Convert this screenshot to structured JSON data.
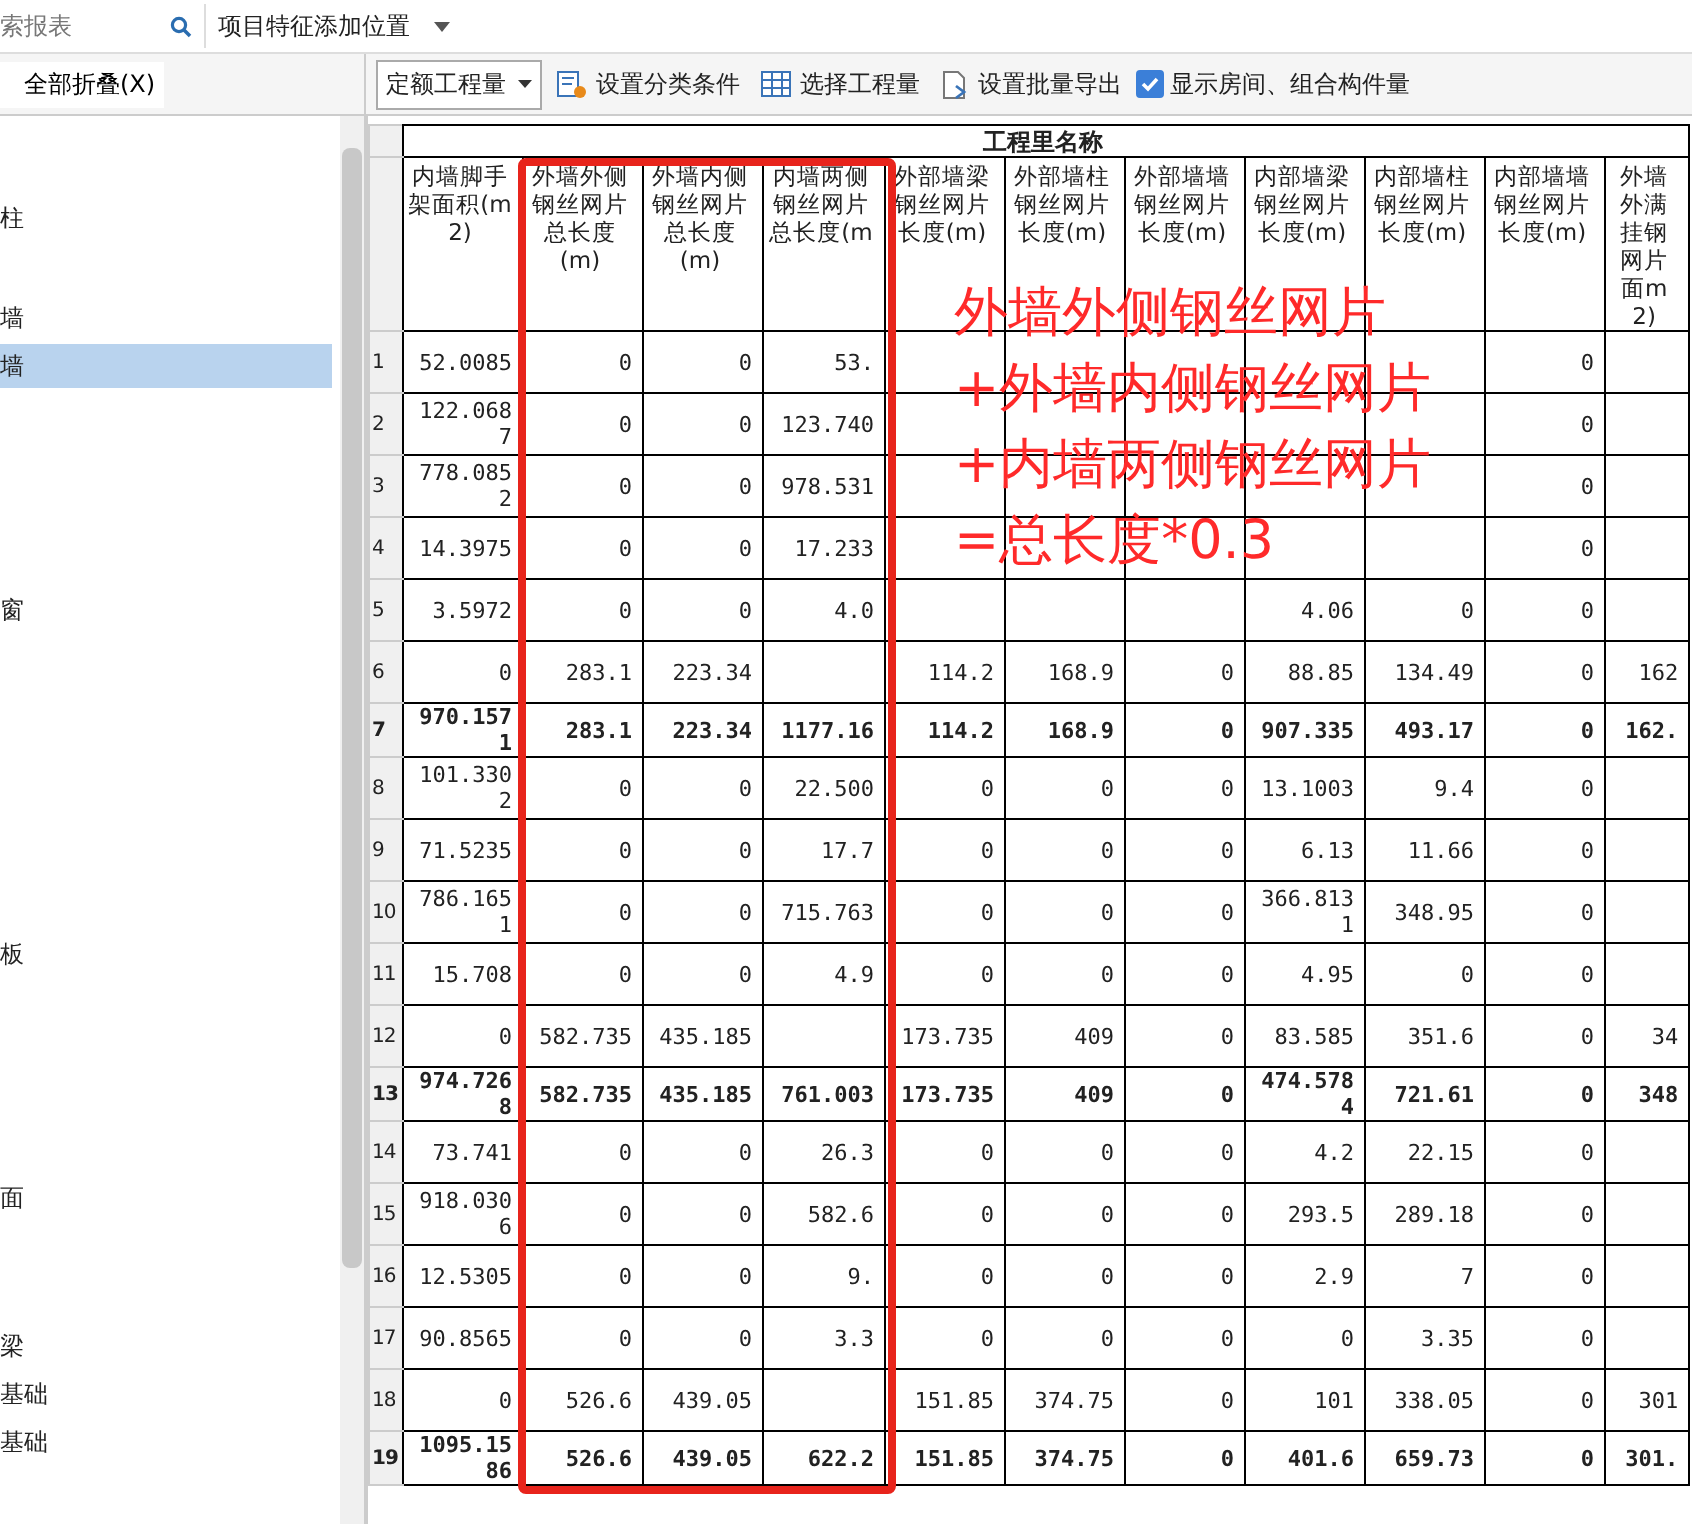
{
  "top_bar": {
    "search": {
      "value": "索报表"
    },
    "position_dropdown": "项目特征添加位置"
  },
  "sidebar": {
    "collapse_all": "全部折叠(X)",
    "items": [
      {
        "label": "柱",
        "selected": false
      },
      {
        "label": "墙",
        "selected": false
      },
      {
        "label": "墙",
        "selected": true
      },
      {
        "label": "窗",
        "selected": false
      },
      {
        "label": "板",
        "selected": false
      },
      {
        "label": "面",
        "selected": false
      },
      {
        "label": "梁",
        "selected": false
      },
      {
        "label": "基础",
        "selected": false
      },
      {
        "label": "基础",
        "selected": false
      }
    ]
  },
  "toolbar": {
    "quantity_dropdown": "定额工程量",
    "buttons": [
      "设置分类条件",
      "选择工程量",
      "设置批量导出"
    ],
    "show_rooms": {
      "label": "显示房间、组合构件量",
      "checked": true
    }
  },
  "table": {
    "group_header": "工程里名称",
    "columns": [
      "内墙脚手架面积(m2)",
      "外墙外侧钢丝网片总长度(m)",
      "外墙内侧钢丝网片总长度(m)",
      "内墙两侧钢丝网片总长度(m",
      "外部墙梁钢丝网片长度(m)",
      "外部墙柱钢丝网片长度(m)",
      "外部墙墙钢丝网片长度(m)",
      "内部墙梁钢丝网片长度(m)",
      "内部墙柱钢丝网片长度(m)",
      "内部墙墙钢丝网片长度(m)",
      "外墙外满挂钢网片面m2)"
    ],
    "rows": [
      {
        "num": "1",
        "kind": "detail",
        "cells": [
          "52.0085",
          "0",
          "0",
          "53.",
          null,
          null,
          null,
          null,
          null,
          "0",
          null
        ]
      },
      {
        "num": "2",
        "kind": "detail",
        "cells": [
          "122.0687",
          "0",
          "0",
          "123.740",
          null,
          null,
          null,
          null,
          null,
          "0",
          null
        ]
      },
      {
        "num": "3",
        "kind": "detail",
        "cells": [
          "778.0852",
          "0",
          "0",
          "978.531",
          null,
          null,
          null,
          null,
          null,
          "0",
          null
        ]
      },
      {
        "num": "4",
        "kind": "detail",
        "cells": [
          "14.3975",
          "0",
          "0",
          "17.233",
          null,
          null,
          null,
          null,
          null,
          "0",
          null
        ]
      },
      {
        "num": "5",
        "kind": "detail",
        "cells": [
          "3.5972",
          "0",
          "0",
          "4.0",
          null,
          null,
          null,
          "4.06",
          "0",
          "0",
          null
        ]
      },
      {
        "num": "6",
        "kind": "detail",
        "cells": [
          "0",
          "283.1",
          "223.34",
          null,
          "114.2",
          "168.9",
          "0",
          "88.85",
          "134.49",
          "0",
          "162"
        ]
      },
      {
        "num": "7",
        "kind": "total",
        "cells": [
          "970.1571",
          "283.1",
          "223.34",
          "1177.16",
          "114.2",
          "168.9",
          "0",
          "907.335",
          "493.17",
          "0",
          "162."
        ]
      },
      {
        "num": "8",
        "kind": "detail",
        "cells": [
          "101.3302",
          "0",
          "0",
          "22.500",
          "0",
          "0",
          "0",
          "13.1003",
          "9.4",
          "0",
          null
        ]
      },
      {
        "num": "9",
        "kind": "detail",
        "cells": [
          "71.5235",
          "0",
          "0",
          "17.7",
          "0",
          "0",
          "0",
          "6.13",
          "11.66",
          "0",
          null
        ]
      },
      {
        "num": "10",
        "kind": "detail",
        "cells": [
          "786.1651",
          "0",
          "0",
          "715.763",
          "0",
          "0",
          "0",
          "366.8131",
          "348.95",
          "0",
          null
        ]
      },
      {
        "num": "11",
        "kind": "detail",
        "cells": [
          "15.708",
          "0",
          "0",
          "4.9",
          "0",
          "0",
          "0",
          "4.95",
          "0",
          "0",
          null
        ]
      },
      {
        "num": "12",
        "kind": "detail",
        "cells": [
          "0",
          "582.735",
          "435.185",
          null,
          "173.735",
          "409",
          "0",
          "83.585",
          "351.6",
          "0",
          "34"
        ]
      },
      {
        "num": "13",
        "kind": "total",
        "cells": [
          "974.7268",
          "582.735",
          "435.185",
          "761.003",
          "173.735",
          "409",
          "0",
          "474.5784",
          "721.61",
          "0",
          "348"
        ]
      },
      {
        "num": "14",
        "kind": "detail",
        "cells": [
          "73.741",
          "0",
          "0",
          "26.3",
          "0",
          "0",
          "0",
          "4.2",
          "22.15",
          "0",
          null
        ]
      },
      {
        "num": "15",
        "kind": "detail",
        "cells": [
          "918.0306",
          "0",
          "0",
          "582.6",
          "0",
          "0",
          "0",
          "293.5",
          "289.18",
          "0",
          null
        ]
      },
      {
        "num": "16",
        "kind": "detail",
        "cells": [
          "12.5305",
          "0",
          "0",
          "9.",
          "0",
          "0",
          "0",
          "2.9",
          "7",
          "0",
          null
        ]
      },
      {
        "num": "17",
        "kind": "detail",
        "cells": [
          "90.8565",
          "0",
          "0",
          "3.3",
          "0",
          "0",
          "0",
          "0",
          "3.35",
          "0",
          null
        ]
      },
      {
        "num": "18",
        "kind": "detail",
        "cells": [
          "0",
          "526.6",
          "439.05",
          null,
          "151.85",
          "374.75",
          "0",
          "101",
          "338.05",
          "0",
          "301"
        ]
      },
      {
        "num": "19",
        "kind": "total",
        "cells": [
          "1095.1586",
          "526.6",
          "439.05",
          "622.2",
          "151.85",
          "374.75",
          "0",
          "401.6",
          "659.73",
          "0",
          "301."
        ]
      }
    ]
  },
  "annotation": "外墙外侧钢丝网片\n+外墙内侧钢丝网片\n+内墙两侧钢丝网片\n=总长度*0.3"
}
